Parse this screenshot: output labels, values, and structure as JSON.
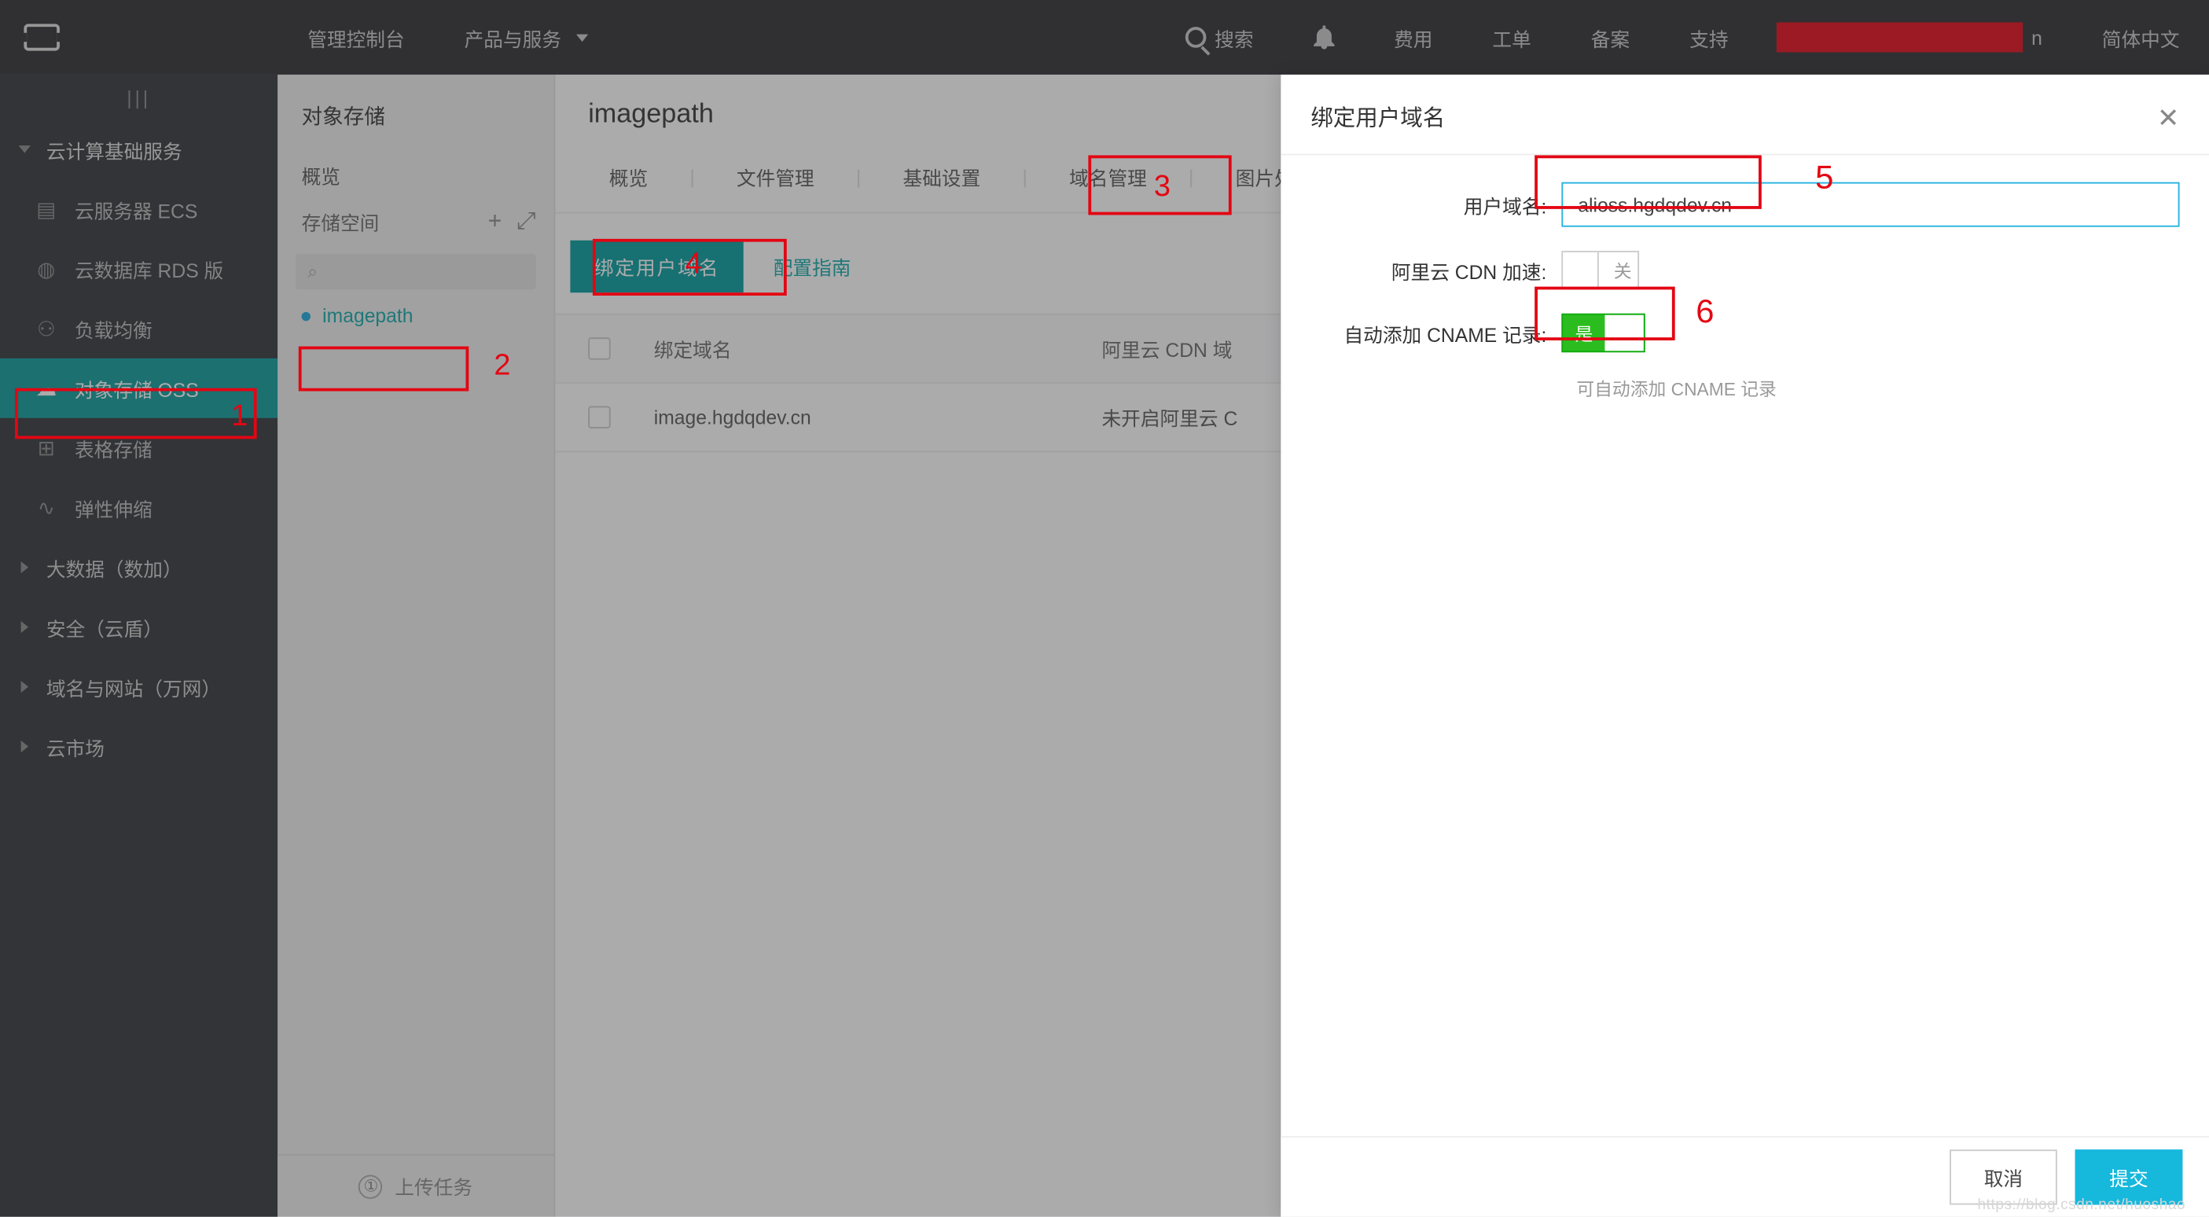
{
  "topbar": {
    "console_label": "管理控制台",
    "products_label": "产品与服务",
    "search_label": "搜索",
    "fee_label": "费用",
    "ticket_label": "工单",
    "beian_label": "备案",
    "support_label": "支持",
    "user_suffix": "n",
    "lang_label": "简体中文"
  },
  "leftnav": {
    "category": "云计算基础服务",
    "items": [
      {
        "icon": "server",
        "label": "云服务器 ECS"
      },
      {
        "icon": "db",
        "label": "云数据库 RDS 版"
      },
      {
        "icon": "slb",
        "label": "负载均衡"
      },
      {
        "icon": "cloud",
        "label": "对象存储 OSS",
        "active": true
      },
      {
        "icon": "table",
        "label": "表格存储"
      },
      {
        "icon": "scale",
        "label": "弹性伸缩"
      }
    ],
    "groups": [
      "大数据（数加）",
      "安全（云盾）",
      "域名与网站（万网）",
      "云市场"
    ]
  },
  "subpanel": {
    "title": "对象存储",
    "overview_label": "概览",
    "space_label": "存储空间",
    "bucket_name": "imagepath",
    "upload_label": "上传任务"
  },
  "content": {
    "title": "imagepath",
    "tabs": [
      "概览",
      "文件管理",
      "基础设置",
      "域名管理",
      "图片处"
    ],
    "bind_btn": "绑定用户域名",
    "guide_link": "配置指南",
    "table": {
      "col_domain": "绑定域名",
      "col_cdn": "阿里云 CDN 域",
      "rows": [
        {
          "domain": "image.hgdqdev.cn",
          "cdn": "未开启阿里云 C"
        }
      ]
    }
  },
  "panel": {
    "title": "绑定用户域名",
    "label_domain": "用户域名:",
    "domain_value": "alioss.hgdqdev.cn",
    "label_cdn": "阿里云 CDN 加速:",
    "cdn_off_text": "关",
    "label_cname": "自动添加 CNAME 记录:",
    "cname_on_text": "是",
    "cname_note": "可自动添加 CNAME 记录",
    "cancel_label": "取消",
    "submit_label": "提交"
  },
  "annotations": {
    "n1": "1",
    "n2": "2",
    "n3": "3",
    "n4": "4",
    "n5": "5",
    "n6": "6"
  }
}
